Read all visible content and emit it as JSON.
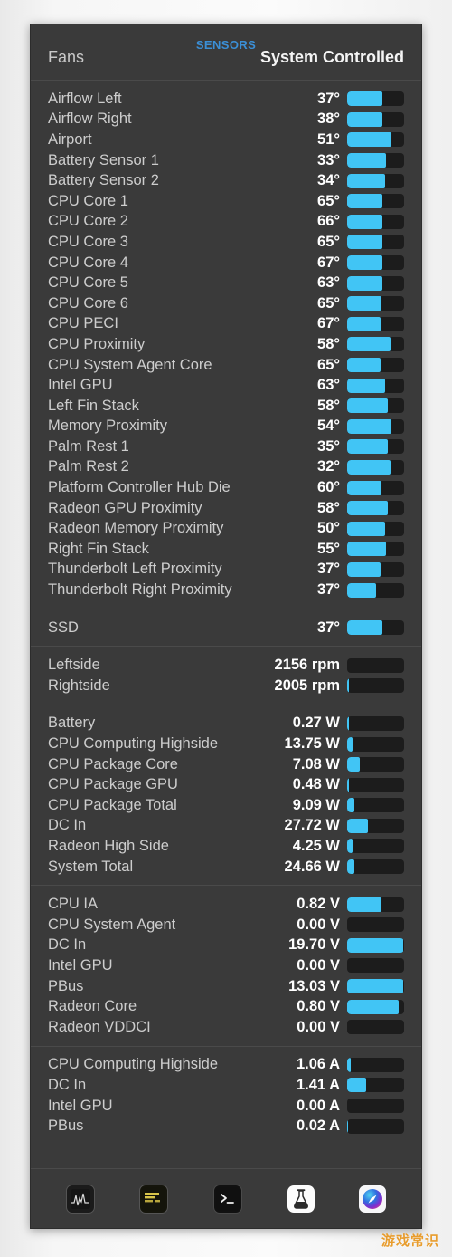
{
  "header": {
    "title": "SENSORS",
    "fans_label": "Fans",
    "fans_mode": "System Controlled",
    "accent_color": "#3b8fd6",
    "bar_fill_color": "#41c5f5",
    "bar_track_color": "#1c1c1c",
    "panel_bg": "#3a3a3a"
  },
  "sections": [
    {
      "name": "temperatures",
      "rows": [
        {
          "label": "Airflow Left",
          "value": "37°",
          "fill_pct": 62
        },
        {
          "label": "Airflow Right",
          "value": "38°",
          "fill_pct": 62
        },
        {
          "label": "Airport",
          "value": "51°",
          "fill_pct": 78
        },
        {
          "label": "Battery Sensor 1",
          "value": "33°",
          "fill_pct": 68
        },
        {
          "label": "Battery Sensor 2",
          "value": "34°",
          "fill_pct": 66
        },
        {
          "label": "CPU Core 1",
          "value": "65°",
          "fill_pct": 62
        },
        {
          "label": "CPU Core 2",
          "value": "66°",
          "fill_pct": 62
        },
        {
          "label": "CPU Core 3",
          "value": "65°",
          "fill_pct": 62
        },
        {
          "label": "CPU Core 4",
          "value": "67°",
          "fill_pct": 62
        },
        {
          "label": "CPU Core 5",
          "value": "63°",
          "fill_pct": 62
        },
        {
          "label": "CPU Core 6",
          "value": "65°",
          "fill_pct": 60
        },
        {
          "label": "CPU PECI",
          "value": "67°",
          "fill_pct": 58
        },
        {
          "label": "CPU Proximity",
          "value": "58°",
          "fill_pct": 76
        },
        {
          "label": "CPU System Agent Core",
          "value": "65°",
          "fill_pct": 58
        },
        {
          "label": "Intel GPU",
          "value": "63°",
          "fill_pct": 66
        },
        {
          "label": "Left Fin Stack",
          "value": "58°",
          "fill_pct": 72
        },
        {
          "label": "Memory Proximity",
          "value": "54°",
          "fill_pct": 78
        },
        {
          "label": "Palm Rest 1",
          "value": "35°",
          "fill_pct": 72
        },
        {
          "label": "Palm Rest 2",
          "value": "32°",
          "fill_pct": 76
        },
        {
          "label": "Platform Controller Hub Die",
          "value": "60°",
          "fill_pct": 60
        },
        {
          "label": "Radeon GPU Proximity",
          "value": "58°",
          "fill_pct": 72
        },
        {
          "label": "Radeon Memory Proximity",
          "value": "50°",
          "fill_pct": 66
        },
        {
          "label": "Right Fin Stack",
          "value": "55°",
          "fill_pct": 68
        },
        {
          "label": "Thunderbolt Left Proximity",
          "value": "37°",
          "fill_pct": 58
        },
        {
          "label": "Thunderbolt Right Proximity",
          "value": "37°",
          "fill_pct": 50
        }
      ]
    },
    {
      "name": "storage-temperature",
      "rows": [
        {
          "label": "SSD",
          "value": "37°",
          "fill_pct": 62
        }
      ]
    },
    {
      "name": "fan-speeds",
      "rows": [
        {
          "label": "Leftside",
          "value": "2156 rpm",
          "fill_pct": 0
        },
        {
          "label": "Rightside",
          "value": "2005 rpm",
          "fill_pct": 3
        }
      ]
    },
    {
      "name": "power",
      "rows": [
        {
          "label": "Battery",
          "value": "0.27 W",
          "fill_pct": 3
        },
        {
          "label": "CPU Computing Highside",
          "value": "13.75 W",
          "fill_pct": 10
        },
        {
          "label": "CPU Package Core",
          "value": "7.08 W",
          "fill_pct": 23
        },
        {
          "label": "CPU Package GPU",
          "value": "0.48 W",
          "fill_pct": 3
        },
        {
          "label": "CPU Package Total",
          "value": "9.09 W",
          "fill_pct": 12
        },
        {
          "label": "DC In",
          "value": "27.72 W",
          "fill_pct": 36
        },
        {
          "label": "Radeon High Side",
          "value": "4.25 W",
          "fill_pct": 9
        },
        {
          "label": "System Total",
          "value": "24.66 W",
          "fill_pct": 13
        }
      ]
    },
    {
      "name": "voltages",
      "rows": [
        {
          "label": "CPU IA",
          "value": "0.82 V",
          "fill_pct": 60
        },
        {
          "label": "CPU System Agent",
          "value": "0.00 V",
          "fill_pct": 0
        },
        {
          "label": "DC In",
          "value": "19.70 V",
          "fill_pct": 99
        },
        {
          "label": "Intel GPU",
          "value": "0.00 V",
          "fill_pct": 0
        },
        {
          "label": "PBus",
          "value": "13.03 V",
          "fill_pct": 99
        },
        {
          "label": "Radeon Core",
          "value": "0.80 V",
          "fill_pct": 90
        },
        {
          "label": "Radeon VDDCI",
          "value": "0.00 V",
          "fill_pct": 0
        }
      ]
    },
    {
      "name": "currents",
      "rows": [
        {
          "label": "CPU Computing Highside",
          "value": "1.06 A",
          "fill_pct": 6
        },
        {
          "label": "DC In",
          "value": "1.41 A",
          "fill_pct": 33
        },
        {
          "label": "Intel GPU",
          "value": "0.00 A",
          "fill_pct": 0
        },
        {
          "label": "PBus",
          "value": "0.02 A",
          "fill_pct": 2
        }
      ]
    }
  ],
  "toolbar": {
    "items": [
      {
        "icon": "activity-monitor-icon",
        "name": "activity-monitor"
      },
      {
        "icon": "warning-log-icon",
        "name": "warning-log"
      },
      {
        "icon": "terminal-icon",
        "name": "terminal"
      },
      {
        "icon": "flask-app-icon",
        "name": "flask-app"
      },
      {
        "icon": "gauge-app-icon",
        "name": "gauge-app"
      }
    ]
  },
  "watermark": {
    "text": "游戏常识",
    "color": "#e8961e"
  }
}
